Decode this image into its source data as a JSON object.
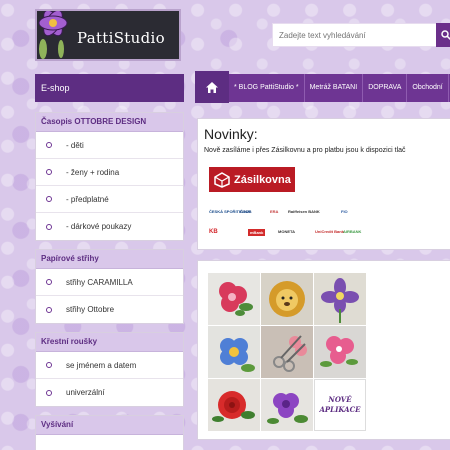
{
  "logo": {
    "text": "PattiStudio"
  },
  "search": {
    "placeholder": "Zadejte text vyhledávání"
  },
  "eshop": {
    "label": "E-shop"
  },
  "nav": {
    "items": [
      "* BLOG PattiStudio *",
      "Metráž BATANI",
      "DOPRAVA",
      "Obchodní"
    ]
  },
  "sidebar": {
    "blocks": [
      {
        "title": "Časopis OTTOBRE DESIGN",
        "items": [
          "- děti",
          "- ženy + rodina",
          "- předplatné",
          "- dárkové poukazy"
        ]
      },
      {
        "title": "Papírové střihy",
        "items": [
          "střihy CARAMILLA",
          "střihy Ottobre"
        ]
      },
      {
        "title": "Křestní roušky",
        "items": [
          "se jménem a datem",
          "univerzální"
        ]
      },
      {
        "title": "Vyšívání",
        "items": []
      }
    ]
  },
  "news": {
    "title": "Novinky:",
    "text": "Nově zasíláme i přes Zásilkovnu a pro platbu jsou k dispozici tlač",
    "zasilkovna": "Zásilkovna",
    "banks": [
      "ČESKÁ SPOŘITELNA",
      "ČSOB",
      "ERA",
      "Raiffeisen BANK",
      "FIO",
      "KB",
      "mBank",
      "MONETA",
      "UniCredit Bank",
      "AIRBANK"
    ]
  },
  "gallery": {
    "tiles": [
      "red-flower-applique",
      "lion-applique",
      "purple-flower-applique",
      "blue-flower-applique",
      "scissors-applique",
      "pink-flower-applique",
      "red-rose-applique",
      "purple-rose-applique",
      "nove-aplikace"
    ],
    "nove_line1": "NOVÉ",
    "nove_line2": "APLIKACE"
  },
  "colors": {
    "brand": "#5d2d82",
    "nav": "#6e3593",
    "sidebar_head": "#d9c7ea",
    "background": "#d9c8ea"
  }
}
